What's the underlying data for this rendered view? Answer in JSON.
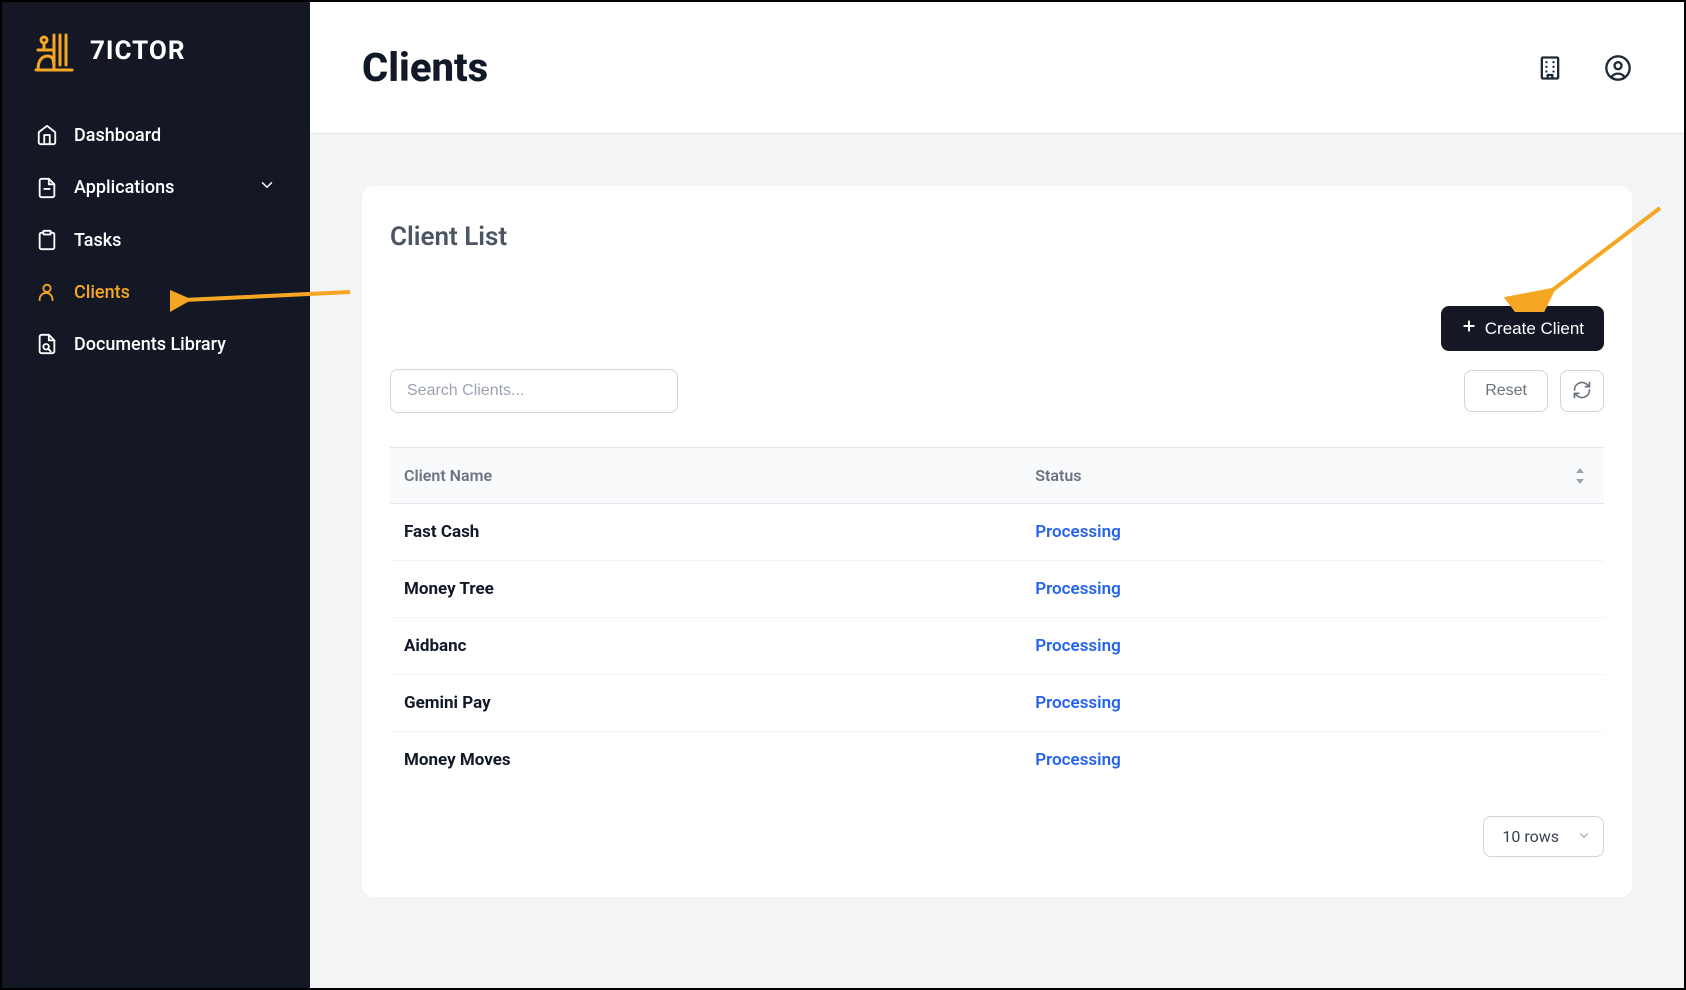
{
  "brand": {
    "name": "7ICTOR"
  },
  "sidebar": {
    "items": [
      {
        "label": "Dashboard",
        "icon": "home-icon",
        "active": false,
        "hasChevron": false
      },
      {
        "label": "Applications",
        "icon": "file-icon",
        "active": false,
        "hasChevron": true
      },
      {
        "label": "Tasks",
        "icon": "clipboard-icon",
        "active": false,
        "hasChevron": false
      },
      {
        "label": "Clients",
        "icon": "user-icon",
        "active": true,
        "hasChevron": false
      },
      {
        "label": "Documents Library",
        "icon": "document-search-icon",
        "active": false,
        "hasChevron": false
      }
    ]
  },
  "header": {
    "title": "Clients"
  },
  "card": {
    "title": "Client List",
    "createButton": "Create Client",
    "search": {
      "placeholder": "Search Clients..."
    },
    "resetButton": "Reset",
    "columns": {
      "name": "Client Name",
      "status": "Status"
    },
    "rows": [
      {
        "name": "Fast Cash",
        "status": "Processing"
      },
      {
        "name": "Money Tree",
        "status": "Processing"
      },
      {
        "name": "Aidbanc",
        "status": "Processing"
      },
      {
        "name": "Gemini Pay",
        "status": "Processing"
      },
      {
        "name": "Money Moves",
        "status": "Processing"
      }
    ],
    "rowsSelector": "10 rows"
  },
  "colors": {
    "accent": "#f5a623",
    "sidebar": "#131824",
    "link": "#2563eb"
  }
}
